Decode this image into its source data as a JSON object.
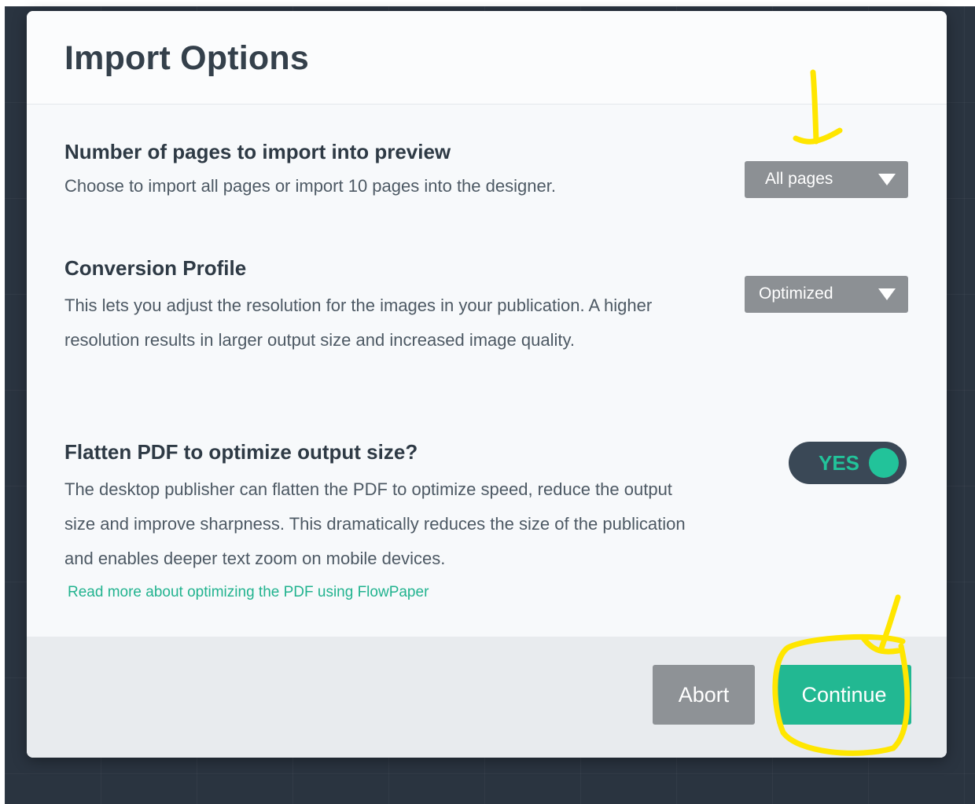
{
  "modal": {
    "title": "Import Options"
  },
  "sections": {
    "pages": {
      "title": "Number of pages to import into preview",
      "description": "Choose to import all pages or import 10 pages into the designer.",
      "select_value": "All pages"
    },
    "profile": {
      "title": "Conversion Profile",
      "description": "This lets you adjust the resolution for the images in your publication. A higher resolution results in larger output size and increased image quality.",
      "select_value": "Optimized"
    },
    "flatten": {
      "title": "Flatten PDF to optimize output size?",
      "description": "The desktop publisher can flatten the PDF to optimize speed, reduce the output size and improve sharpness. This dramatically reduces the size of the publication and enables deeper text zoom on mobile devices.",
      "link_text": "Read more about optimizing the PDF using FlowPaper",
      "toggle_label": "YES",
      "toggle_on": true
    }
  },
  "footer": {
    "abort_label": "Abort",
    "continue_label": "Continue"
  },
  "colors": {
    "accent": "#22b892",
    "select_bg": "#8c9094",
    "toggle_bg": "#3a4856",
    "annotation": "#ffe600"
  },
  "icons": {
    "dropdown": "caret-down-icon"
  }
}
